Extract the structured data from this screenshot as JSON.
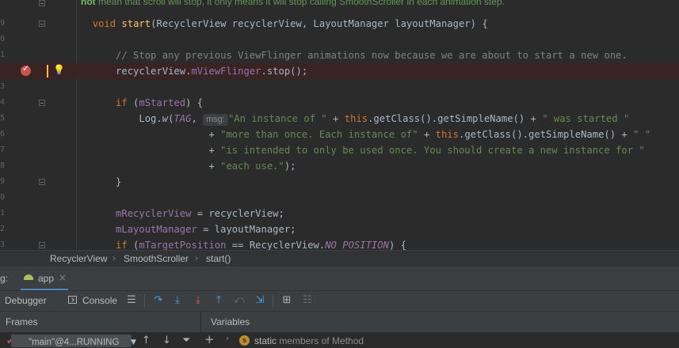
{
  "editor": {
    "doc_comment": {
      "bold": "not",
      "text": " mean that scroll will stop, it only means it will stop calling SmoothScroller in each animation step."
    },
    "line_numbers": [
      "9",
      "0",
      "1",
      "2",
      "3",
      "4",
      "5",
      "6",
      "7",
      "8",
      "9",
      "0",
      "1",
      "2",
      "3"
    ],
    "code": {
      "l1": {
        "kw_void": "void",
        "fn_start": "start",
        "params": "(RecyclerView recyclerView, LayoutManager layoutManager) {"
      },
      "l3": {
        "comment": "// Stop any previous ViewFlinger animations now because we are about to start a new one."
      },
      "l4": {
        "a": "recyclerView.",
        "field": "mViewFlinger",
        "b": ".stop();"
      },
      "l6": {
        "kw_if": "if",
        "a": " (",
        "field": "mStarted",
        "b": ") {"
      },
      "l7": {
        "a": "Log.",
        "method": "w",
        "b": "(",
        "const": "TAG",
        "c": ",",
        "hint": "msg:",
        "str1": "\"An instance of \"",
        "d": " + ",
        "kw_this": "this",
        "e": ".getClass().getSimpleName() + ",
        "str2": "\" was started \""
      },
      "l8": {
        "a": "+ ",
        "str1": "\"more than once. Each instance of\"",
        "b": " + ",
        "kw_this": "this",
        "c": ".getClass().getSimpleName() + ",
        "str2": "\" \""
      },
      "l9": {
        "a": "+ ",
        "str": "\"is intended to only be used once. You should create a new instance for \""
      },
      "l10": {
        "a": "+ ",
        "str": "\"each use.\"",
        "b": ");"
      },
      "l11": {
        "a": "}"
      },
      "l13": {
        "field": "mRecyclerView",
        "a": " = recyclerView;"
      },
      "l14": {
        "field": "mLayoutManager",
        "a": " = layoutManager;"
      },
      "l15": {
        "kw_if": "if",
        "a": " (",
        "field": "mTargetPosition",
        "b": " == RecyclerView.",
        "const": "NO_POSITION",
        "c": ") {"
      }
    }
  },
  "breadcrumb": {
    "items": [
      "RecyclerView",
      "SmoothScroller",
      "start()"
    ]
  },
  "tool_window": {
    "label": "g:",
    "tab_name": "app",
    "tab_close": "×"
  },
  "toolbar": {
    "debugger": "Debugger",
    "console": "Console"
  },
  "frames": {
    "title": "Frames",
    "thread": "\"main\"@4...RUNNING"
  },
  "variables": {
    "title": "Variables",
    "static_badge": "s",
    "keyword": "static",
    "rest": " members of Method"
  },
  "colors": {
    "accent": "#4a88c7",
    "breakpoint": "#c75450",
    "keyword": "#cc7832",
    "string": "#6a8759",
    "field": "#9876aa"
  },
  "icons": [
    "breakpoint-icon",
    "bulb-icon",
    "android-icon",
    "console-icon",
    "step-over-icon",
    "step-into-icon",
    "force-step-into-icon",
    "step-out-icon",
    "drop-frame-icon",
    "run-to-cursor-icon",
    "evaluate-icon",
    "trace-icon",
    "up-arrow-icon",
    "down-arrow-icon",
    "filter-icon",
    "add-icon",
    "expand-icon",
    "static-icon"
  ]
}
